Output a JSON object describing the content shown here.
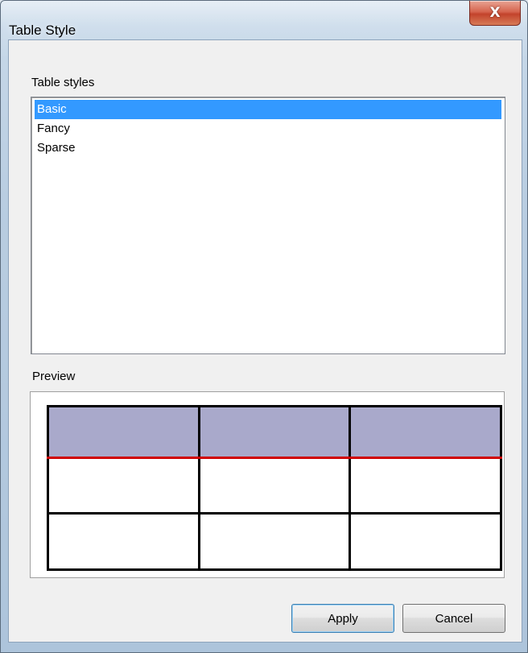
{
  "window": {
    "title": "Table Style"
  },
  "titlebar": {
    "close_glyph": "X",
    "close_icon": "close-icon"
  },
  "table_styles": {
    "label": "Table styles",
    "items": [
      {
        "label": "Basic",
        "selected": true
      },
      {
        "label": "Fancy",
        "selected": false
      },
      {
        "label": "Sparse",
        "selected": false
      }
    ]
  },
  "preview": {
    "label": "Preview",
    "columns": 3,
    "rows": 3,
    "header_fill": "#a9a9cb",
    "header_rule_color": "#d00000",
    "border_color": "#000000"
  },
  "buttons": {
    "apply_label": "Apply",
    "cancel_label": "Cancel"
  },
  "colors": {
    "selection": "#3399ff",
    "close_button": "#d6654f"
  }
}
